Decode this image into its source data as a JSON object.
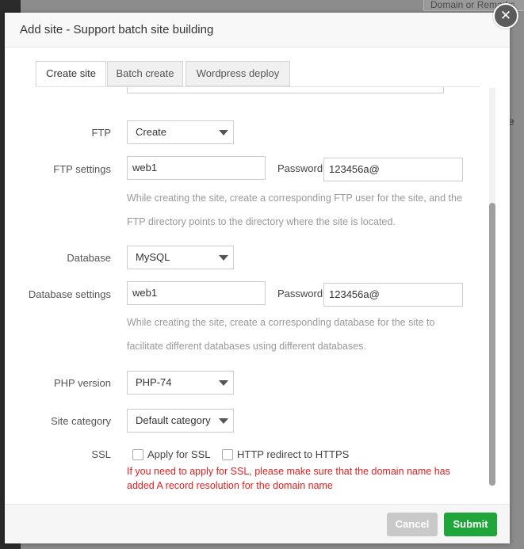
{
  "background": {
    "remarks_placeholder": "Domain or Remarks",
    "partial_text": "e"
  },
  "dialog": {
    "title": "Add site - Support batch site building",
    "close_icon": "close-icon"
  },
  "tabs": [
    {
      "label": "Create site",
      "active": true
    },
    {
      "label": "Batch create",
      "active": false
    },
    {
      "label": "Wordpress deploy",
      "active": false
    }
  ],
  "form": {
    "ftp": {
      "label": "FTP",
      "value": "Create"
    },
    "ftp_settings": {
      "label": "FTP settings",
      "username": "web1",
      "password_label": "Password",
      "password": "123456a@",
      "hint_line1": "While creating the site, create a corresponding FTP user for the site, and the",
      "hint_line2": "FTP directory points to the directory where the site is located."
    },
    "database": {
      "label": "Database",
      "value": "MySQL"
    },
    "database_settings": {
      "label": "Database settings",
      "username": "web1",
      "password_label": "Password",
      "password": "123456a@",
      "hint_line1": "While creating the site, create a corresponding database for the site to",
      "hint_line2": "facilitate different databases using different databases."
    },
    "php_version": {
      "label": "PHP version",
      "value": "PHP-74"
    },
    "site_category": {
      "label": "Site category",
      "value": "Default category"
    },
    "ssl": {
      "label": "SSL",
      "apply_label": "Apply for SSL",
      "apply_checked": false,
      "redirect_label": "HTTP redirect to HTTPS",
      "redirect_checked": false,
      "warning_line1": "If you need to apply for SSL, please make sure that the domain name has",
      "warning_line2": "added A record resolution for the domain name"
    }
  },
  "footer": {
    "cancel_label": "Cancel",
    "submit_label": "Submit"
  },
  "colors": {
    "submit": "#20a53a",
    "cancel": "#c9c9c9",
    "warning": "#e02020"
  }
}
